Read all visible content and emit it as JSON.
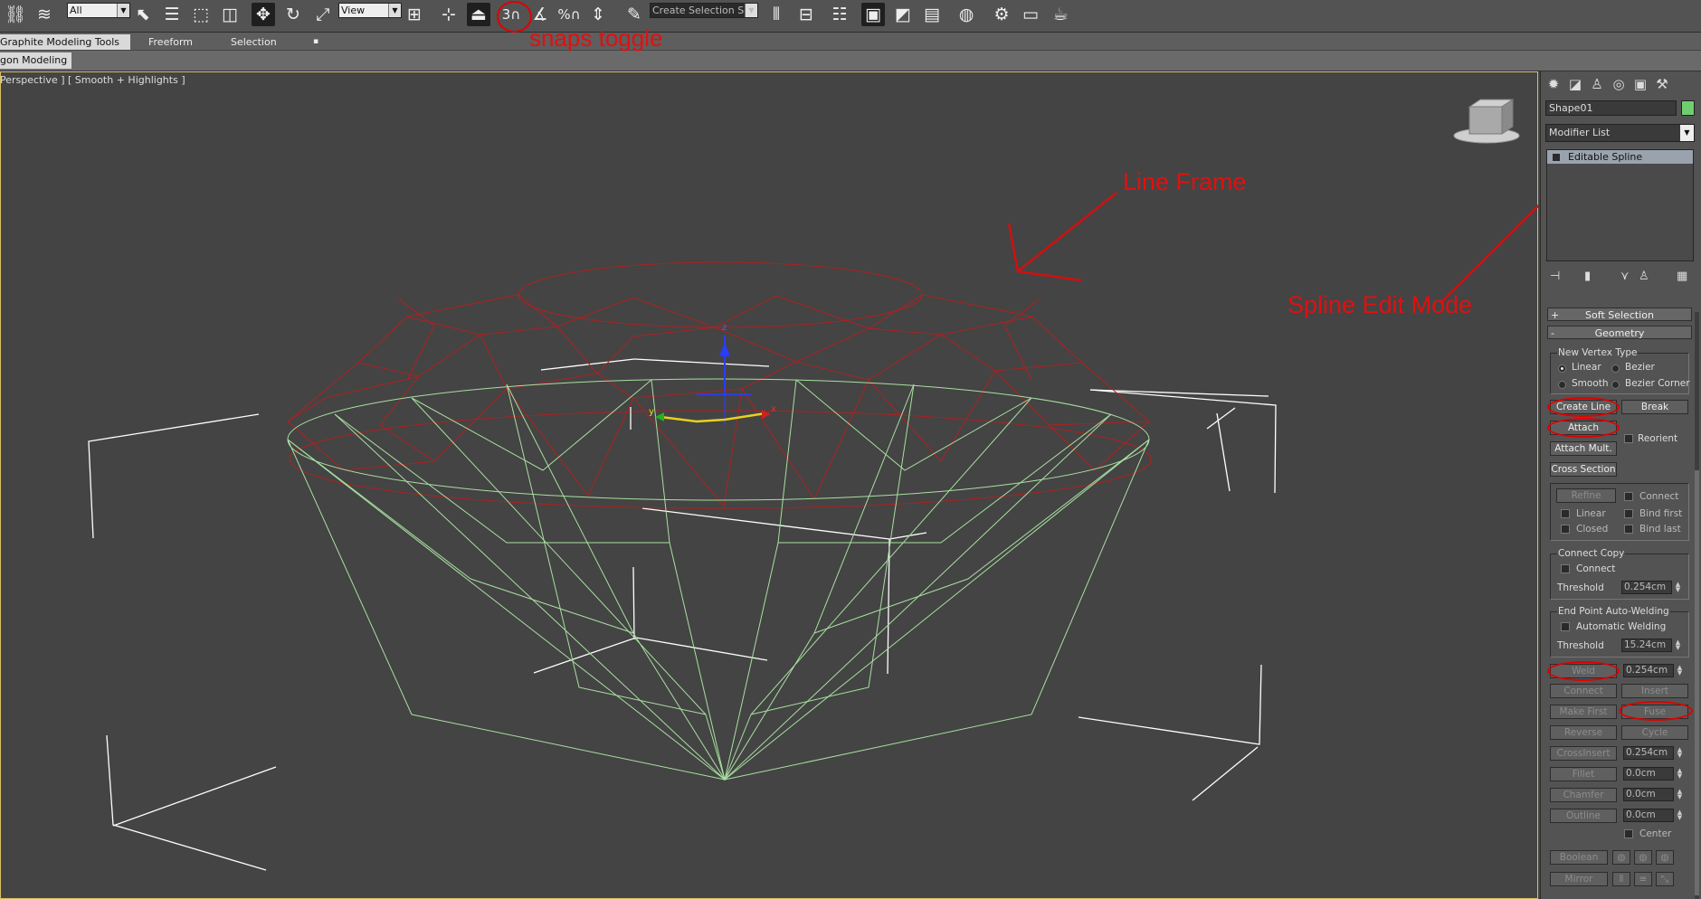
{
  "toolbar": {
    "selection_filter": "All",
    "coord_system": "View",
    "named_selection_placeholder": "Create Selection Se",
    "snaps_number": "3",
    "icons": [
      "select-link-icon",
      "unlink-icon",
      "filter-icon",
      "select-object-icon",
      "select-by-name-icon",
      "rect-region-icon",
      "window-crossing-icon",
      "move-icon",
      "rotate-icon",
      "scale-icon",
      "pivot-icon",
      "manipulate-icon",
      "keyboard-shortcut-icon",
      "snaps-toggle-icon",
      "angle-snap-icon",
      "percent-snap-icon",
      "spinner-snap-icon",
      "edit-named-selection-icon",
      "mirror-icon",
      "align-icon",
      "layer-manager-icon",
      "scene-explorer-icon",
      "curve-editor-icon",
      "schematic-view-icon",
      "material-editor-icon",
      "render-setup-icon",
      "rendered-frame-icon",
      "render-icon"
    ]
  },
  "ribbon_tabs": [
    "Graphite Modeling Tools",
    "Freeform",
    "Selection"
  ],
  "ribbon_panel": "gon Modeling",
  "viewport": {
    "label": "Perspective ] [ Smooth + Highlights ]",
    "axis_x": "x",
    "axis_y": "y",
    "axis_z": "z"
  },
  "annotations": {
    "snaps": "snaps toggle",
    "line_frame": "Line Frame",
    "spline_mode": "Spline Edit Mode",
    "color": "#e01010"
  },
  "command_panel": {
    "object_name": "Shape01",
    "object_color": "#6fcf6f",
    "modifier_list": "Modifier List",
    "stack_item": "Editable Spline",
    "rollouts": {
      "soft_selection": "Soft Selection",
      "geometry": "Geometry",
      "plus": "+",
      "minus": "-"
    },
    "vertex_type": {
      "title": "New Vertex Type",
      "linear": "Linear",
      "bezier": "Bezier",
      "smooth": "Smooth",
      "bezier_corner": "Bezier Corner"
    },
    "buttons": {
      "create_line": "Create Line",
      "break": "Break",
      "attach": "Attach",
      "reorient": "Reorient",
      "attach_mult": "Attach Mult.",
      "cross_section": "Cross Section",
      "refine": "Refine",
      "connect": "Connect",
      "linear": "Linear",
      "bind_first": "Bind first",
      "closed": "Closed",
      "bind_last": "Bind last"
    },
    "connect_copy": {
      "title": "Connect Copy",
      "connect": "Connect",
      "threshold_label": "Threshold",
      "threshold": "0.254cm"
    },
    "auto_weld": {
      "title": "End Point Auto-Welding",
      "automatic": "Automatic Welding",
      "threshold_label": "Threshold",
      "threshold": "15.24cm"
    },
    "ops": {
      "weld": "Weld",
      "weld_val": "0.254cm",
      "connect": "Connect",
      "insert": "Insert",
      "make_first": "Make First",
      "fuse": "Fuse",
      "reverse": "Reverse",
      "cycle": "Cycle",
      "crossinsert": "CrossInsert",
      "crossinsert_val": "0.254cm",
      "fillet": "Fillet",
      "fillet_val": "0.0cm",
      "chamfer": "Chamfer",
      "chamfer_val": "0.0cm",
      "outline": "Outline",
      "outline_val": "0.0cm",
      "center": "Center",
      "boolean": "Boolean",
      "mirror": "Mirror"
    }
  }
}
